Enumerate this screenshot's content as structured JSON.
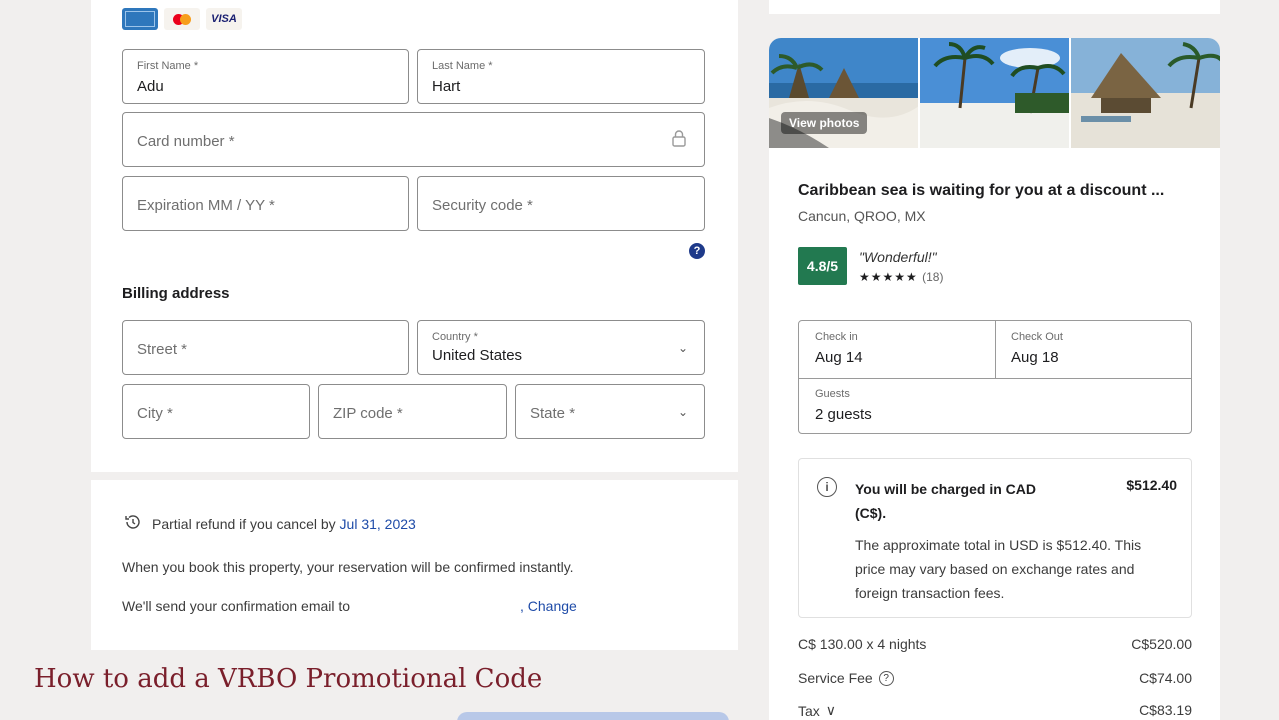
{
  "payment": {
    "card_logos": [
      "amex-logo",
      "mastercard-logo",
      "visa-logo"
    ],
    "visa_text": "VISA",
    "first_name": {
      "label": "First Name *",
      "value": "Adu"
    },
    "last_name": {
      "label": "Last Name *",
      "value": "Hart"
    },
    "card_number": {
      "placeholder": "Card number *"
    },
    "expiration": {
      "placeholder": "Expiration MM / YY *"
    },
    "security_code": {
      "placeholder": "Security code *"
    },
    "help_glyph": "?"
  },
  "billing": {
    "title": "Billing address",
    "street": {
      "placeholder": "Street *"
    },
    "country": {
      "label": "Country *",
      "value": "United States"
    },
    "city": {
      "placeholder": "City *"
    },
    "zip": {
      "placeholder": "ZIP code *"
    },
    "state": {
      "placeholder": "State *"
    }
  },
  "policy": {
    "refund_text": "Partial refund if you cancel by",
    "refund_date": "Jul 31, 2023",
    "confirm_text": "When you book this property, your reservation will be confirmed instantly.",
    "email_text": "We'll send your confirmation email to",
    "change_link": ", Change"
  },
  "watermark": "How to add a VRBO Promotional Code",
  "property": {
    "view_photos": "View photos",
    "title": "Caribbean sea is waiting for you at a discount ...",
    "location": "Cancun, QROO, MX",
    "rating": "4.8/5",
    "rating_word": "\"Wonderful!\"",
    "stars": "★★★★★",
    "review_count": "(18)",
    "check_in": {
      "label": "Check in",
      "value": "Aug 14"
    },
    "check_out": {
      "label": "Check Out",
      "value": "Aug 18"
    },
    "guests": {
      "label": "Guests",
      "value": "2 guests"
    }
  },
  "notice": {
    "info_glyph": "i",
    "title": "You will be charged in CAD (C$).",
    "amount": "$512.40",
    "body": "The approximate total in USD is $512.40. This price may vary based on exchange rates and foreign transaction fees."
  },
  "pricing": [
    {
      "label": "C$ 130.00 x 4 nights",
      "value": "C$520.00"
    },
    {
      "label": "Service Fee",
      "value": "C$74.00",
      "icon": "?"
    },
    {
      "label": "Tax",
      "value": "C$83.19",
      "icon": "∨"
    }
  ],
  "colors": {
    "rating_green": "#227950",
    "link_blue": "#1e4ba8",
    "watermark": "#7a1f2b"
  }
}
